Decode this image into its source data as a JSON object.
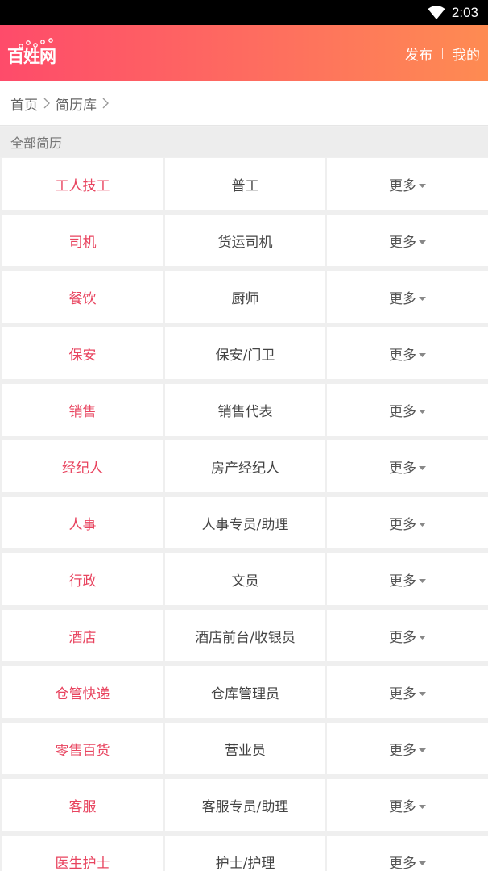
{
  "status_bar": {
    "time": "2:03",
    "wifi_icon": "wifi-icon"
  },
  "header": {
    "logo_text": "百姓网",
    "publish_label": "发布",
    "mine_label": "我的",
    "gradient_start": "#fe4b6a",
    "gradient_end": "#fe8b52"
  },
  "breadcrumb": {
    "home": "首页",
    "resume_lib": "简历库"
  },
  "section": {
    "title": "全部简历"
  },
  "accent_color": "#e8445f",
  "rows": [
    {
      "category": "工人技工",
      "sub": "普工",
      "more": "更多"
    },
    {
      "category": "司机",
      "sub": "货运司机",
      "more": "更多"
    },
    {
      "category": "餐饮",
      "sub": "厨师",
      "more": "更多"
    },
    {
      "category": "保安",
      "sub": "保安/门卫",
      "more": "更多"
    },
    {
      "category": "销售",
      "sub": "销售代表",
      "more": "更多"
    },
    {
      "category": "经纪人",
      "sub": "房产经纪人",
      "more": "更多"
    },
    {
      "category": "人事",
      "sub": "人事专员/助理",
      "more": "更多"
    },
    {
      "category": "行政",
      "sub": "文员",
      "more": "更多"
    },
    {
      "category": "酒店",
      "sub": "酒店前台/收银员",
      "more": "更多"
    },
    {
      "category": "仓管快递",
      "sub": "仓库管理员",
      "more": "更多"
    },
    {
      "category": "零售百货",
      "sub": "营业员",
      "more": "更多"
    },
    {
      "category": "客服",
      "sub": "客服专员/助理",
      "more": "更多"
    },
    {
      "category": "医生护士",
      "sub": "护士/护理",
      "more": "更多"
    }
  ]
}
